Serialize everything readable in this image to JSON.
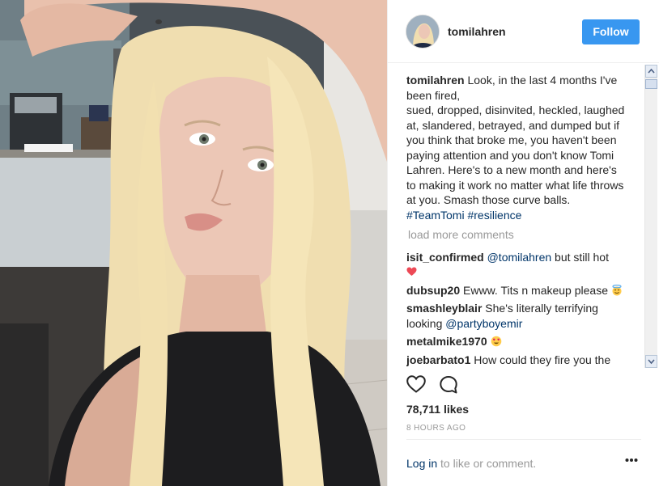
{
  "photo": {
    "description_icon": "selfie-photo"
  },
  "header": {
    "username": "tomilahren",
    "follow_label": "Follow"
  },
  "caption": {
    "user": "tomilahren",
    "text_1": "Look, in the last 4 months I've been fired,",
    "text_2": "sued, dropped, disinvited, heckled, laughed at, slandered, betrayed, and dumped but if you think that broke me, you haven't been paying attention and you don't know Tomi Lahren. Here's to a new month and here's to making it work no matter what life throws at you. Smash those curve balls. ",
    "tag_1": "#TeamTomi",
    "tag_2": "#resilience"
  },
  "load_more": "load more comments",
  "comments": [
    {
      "user": "isit_confirmed",
      "mention": "@tomilahren",
      "text": " but still hot",
      "emoji": "heart"
    },
    {
      "user": "dubsup20",
      "text": "Ewww. Tits n makeup please",
      "emoji": "smiling-face-with-halo"
    },
    {
      "user": "smashleyblair",
      "text": "She's literally terrifying looking ",
      "mention": "@partyboyemir"
    },
    {
      "user": "metalmike1970",
      "text": "",
      "emoji": "heart-eyes-face"
    },
    {
      "user": "joebarbato1",
      "text": "How could they fire you the"
    }
  ],
  "actions": {
    "like_icon": "heart-outline-icon",
    "comment_icon": "speech-bubble-icon"
  },
  "likes": "78,711 likes",
  "timestamp": "8 HOURS AGO",
  "footer": {
    "login_link": "Log in",
    "login_rest": " to like or comment.",
    "more_icon": "ellipsis-icon"
  },
  "colors": {
    "accent": "#3897f0",
    "link": "#003569",
    "muted": "#999999",
    "text": "#262626",
    "heart": "#ed4956"
  }
}
